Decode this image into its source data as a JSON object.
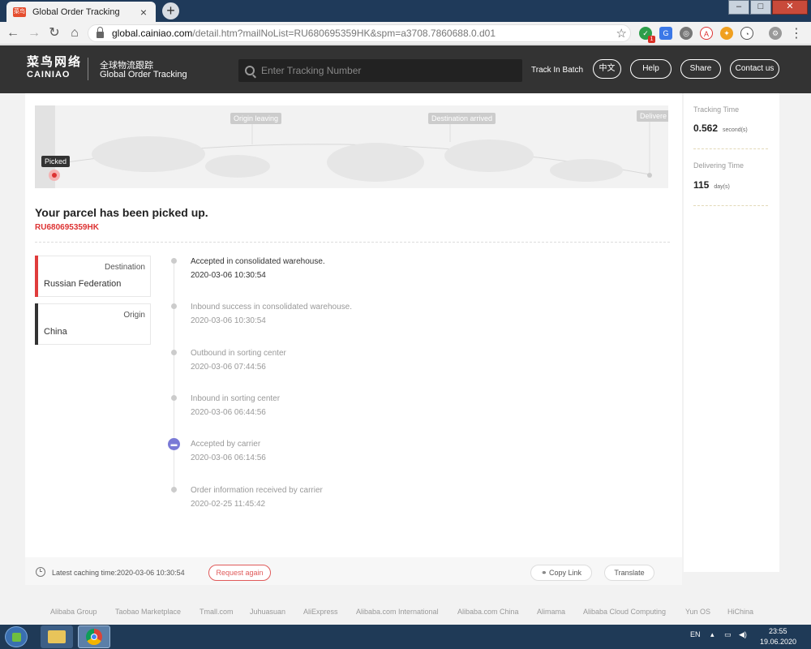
{
  "browser": {
    "tab_title": "Global Order Tracking",
    "tab_favicon": "菜鸟",
    "tab_close": "×",
    "new_tab": "+",
    "url_host": "global.cainiao.com",
    "url_path": "/detail.htm?mailNoList=RU680695359HK&spm=a3708.7860688.0.d01",
    "back": "←",
    "forward": "→",
    "reload": "↻",
    "home": "⌂",
    "star": "☆",
    "menu": "⋮",
    "extension_badge": "1"
  },
  "header": {
    "logo_cn": "菜鸟网络",
    "logo_en": "CAINIAO",
    "subtitle_cn": "全球物流跟踪",
    "subtitle_en": "Global Order Tracking",
    "search_placeholder": "Enter Tracking Number",
    "track_in_batch": "Track In Batch",
    "lang_button": "中文",
    "help_button": "Help",
    "share_button": "Share",
    "contact_button": "Contact us"
  },
  "progress": {
    "stages": [
      {
        "label": "Picked",
        "active": true
      },
      {
        "label": "Origin leaving",
        "active": false
      },
      {
        "label": "Destination arrived",
        "active": false
      },
      {
        "label": "Delivere",
        "active": false
      }
    ]
  },
  "parcel": {
    "status_title": "Your parcel has been picked up.",
    "tracking_number": "RU680695359HK"
  },
  "locations": {
    "destination_label": "Destination",
    "destination_value": "Russian Federation",
    "origin_label": "Origin",
    "origin_value": "China"
  },
  "events": [
    {
      "desc": "Accepted in consolidated warehouse.",
      "time": "2020-03-06 10:30:54"
    },
    {
      "desc": "Inbound success in consolidated warehouse.",
      "time": "2020-03-06 10:30:54"
    },
    {
      "desc": "Outbound in sorting center",
      "time": "2020-03-06 07:44:56"
    },
    {
      "desc": "Inbound in sorting center",
      "time": "2020-03-06 06:44:56"
    },
    {
      "desc": "Accepted by carrier",
      "time": "2020-03-06 06:14:56"
    },
    {
      "desc": "Order information received by carrier",
      "time": "2020-02-25 11:45:42"
    }
  ],
  "stats": {
    "tracking_time_label": "Tracking Time",
    "tracking_time_value": "0.562",
    "tracking_time_unit": "second(s)",
    "delivering_time_label": "Delivering Time",
    "delivering_time_value": "115",
    "delivering_time_unit": "day(s)"
  },
  "footer": {
    "caching_text": "Latest caching time:2020-03-06 10:30:54",
    "request_again": "Request again",
    "copy_link": "Copy Link",
    "translate": "Translate",
    "links": [
      "Alibaba Group",
      "Taobao Marketplace",
      "Tmall.com",
      "Juhuasuan",
      "AliExpress",
      "Alibaba.com International",
      "Alibaba.com China",
      "Alimama",
      "Alibaba Cloud Computing",
      "Yun OS",
      "HiChina"
    ]
  },
  "taskbar": {
    "language": "EN",
    "time": "23:55",
    "date": "19.06.2020"
  },
  "colors": {
    "header_bg": "#333333",
    "accent_red": "#d33333",
    "carrier_purple": "#7a7ad6"
  }
}
